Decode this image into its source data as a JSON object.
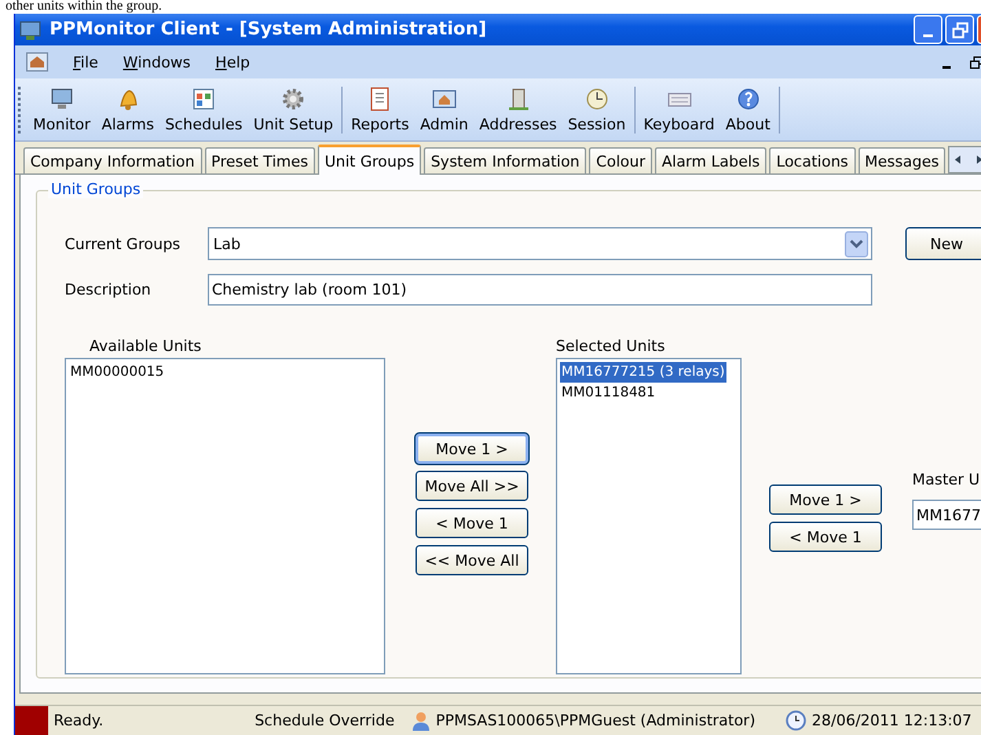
{
  "document_text": "other units within the group.",
  "window": {
    "title": "PPMonitor Client - [System Administration]"
  },
  "menu": [
    {
      "label": "File"
    },
    {
      "label": "Windows"
    },
    {
      "label": "Help"
    }
  ],
  "toolbar_groups": [
    {
      "items": [
        {
          "label": "Monitor"
        },
        {
          "label": "Alarms"
        },
        {
          "label": "Schedules"
        },
        {
          "label": "Unit Setup"
        }
      ]
    },
    {
      "items": [
        {
          "label": "Reports"
        },
        {
          "label": "Admin"
        },
        {
          "label": "Addresses"
        },
        {
          "label": "Session"
        }
      ]
    },
    {
      "items": [
        {
          "label": "Keyboard"
        },
        {
          "label": "About"
        }
      ]
    }
  ],
  "tabs": [
    {
      "label": "Company Information",
      "selected": false
    },
    {
      "label": "Preset Times",
      "selected": false
    },
    {
      "label": "Unit Groups",
      "selected": true
    },
    {
      "label": "System Information",
      "selected": false
    },
    {
      "label": "Colour",
      "selected": false
    },
    {
      "label": "Alarm Labels",
      "selected": false
    },
    {
      "label": "Locations",
      "selected": false
    },
    {
      "label": "Messages",
      "selected": false
    }
  ],
  "group_title": "Unit Groups",
  "current_groups": {
    "label": "Current Groups",
    "value": "Lab"
  },
  "new_button": "New",
  "description": {
    "label": "Description",
    "value": "Chemistry lab (room 101)"
  },
  "available_units": {
    "label": "Available Units",
    "items": [
      {
        "text": "MM00000015",
        "selected": false
      }
    ]
  },
  "move_buttons": [
    {
      "label": "Move 1 >",
      "focused": true
    },
    {
      "label": "Move All >>",
      "focused": false
    },
    {
      "label": "< Move 1",
      "focused": false
    },
    {
      "label": "<< Move All",
      "focused": false
    }
  ],
  "selected_units": {
    "label": "Selected Units",
    "items": [
      {
        "text": "MM16777215 (3 relays)",
        "selected": true
      },
      {
        "text": "MM01118481",
        "selected": false
      }
    ]
  },
  "master_buttons": [
    {
      "label": "Move 1 >",
      "focused": false
    },
    {
      "label": "< Move 1",
      "focused": false
    }
  ],
  "master_unit": {
    "label": "Master U",
    "value": "MM1677"
  },
  "status_bar": {
    "state": "Ready.",
    "mode": "Schedule Override",
    "user": "PPMSAS100065\\PPMGuest (Administrator)",
    "time": "28/06/2011 12:13:07"
  }
}
